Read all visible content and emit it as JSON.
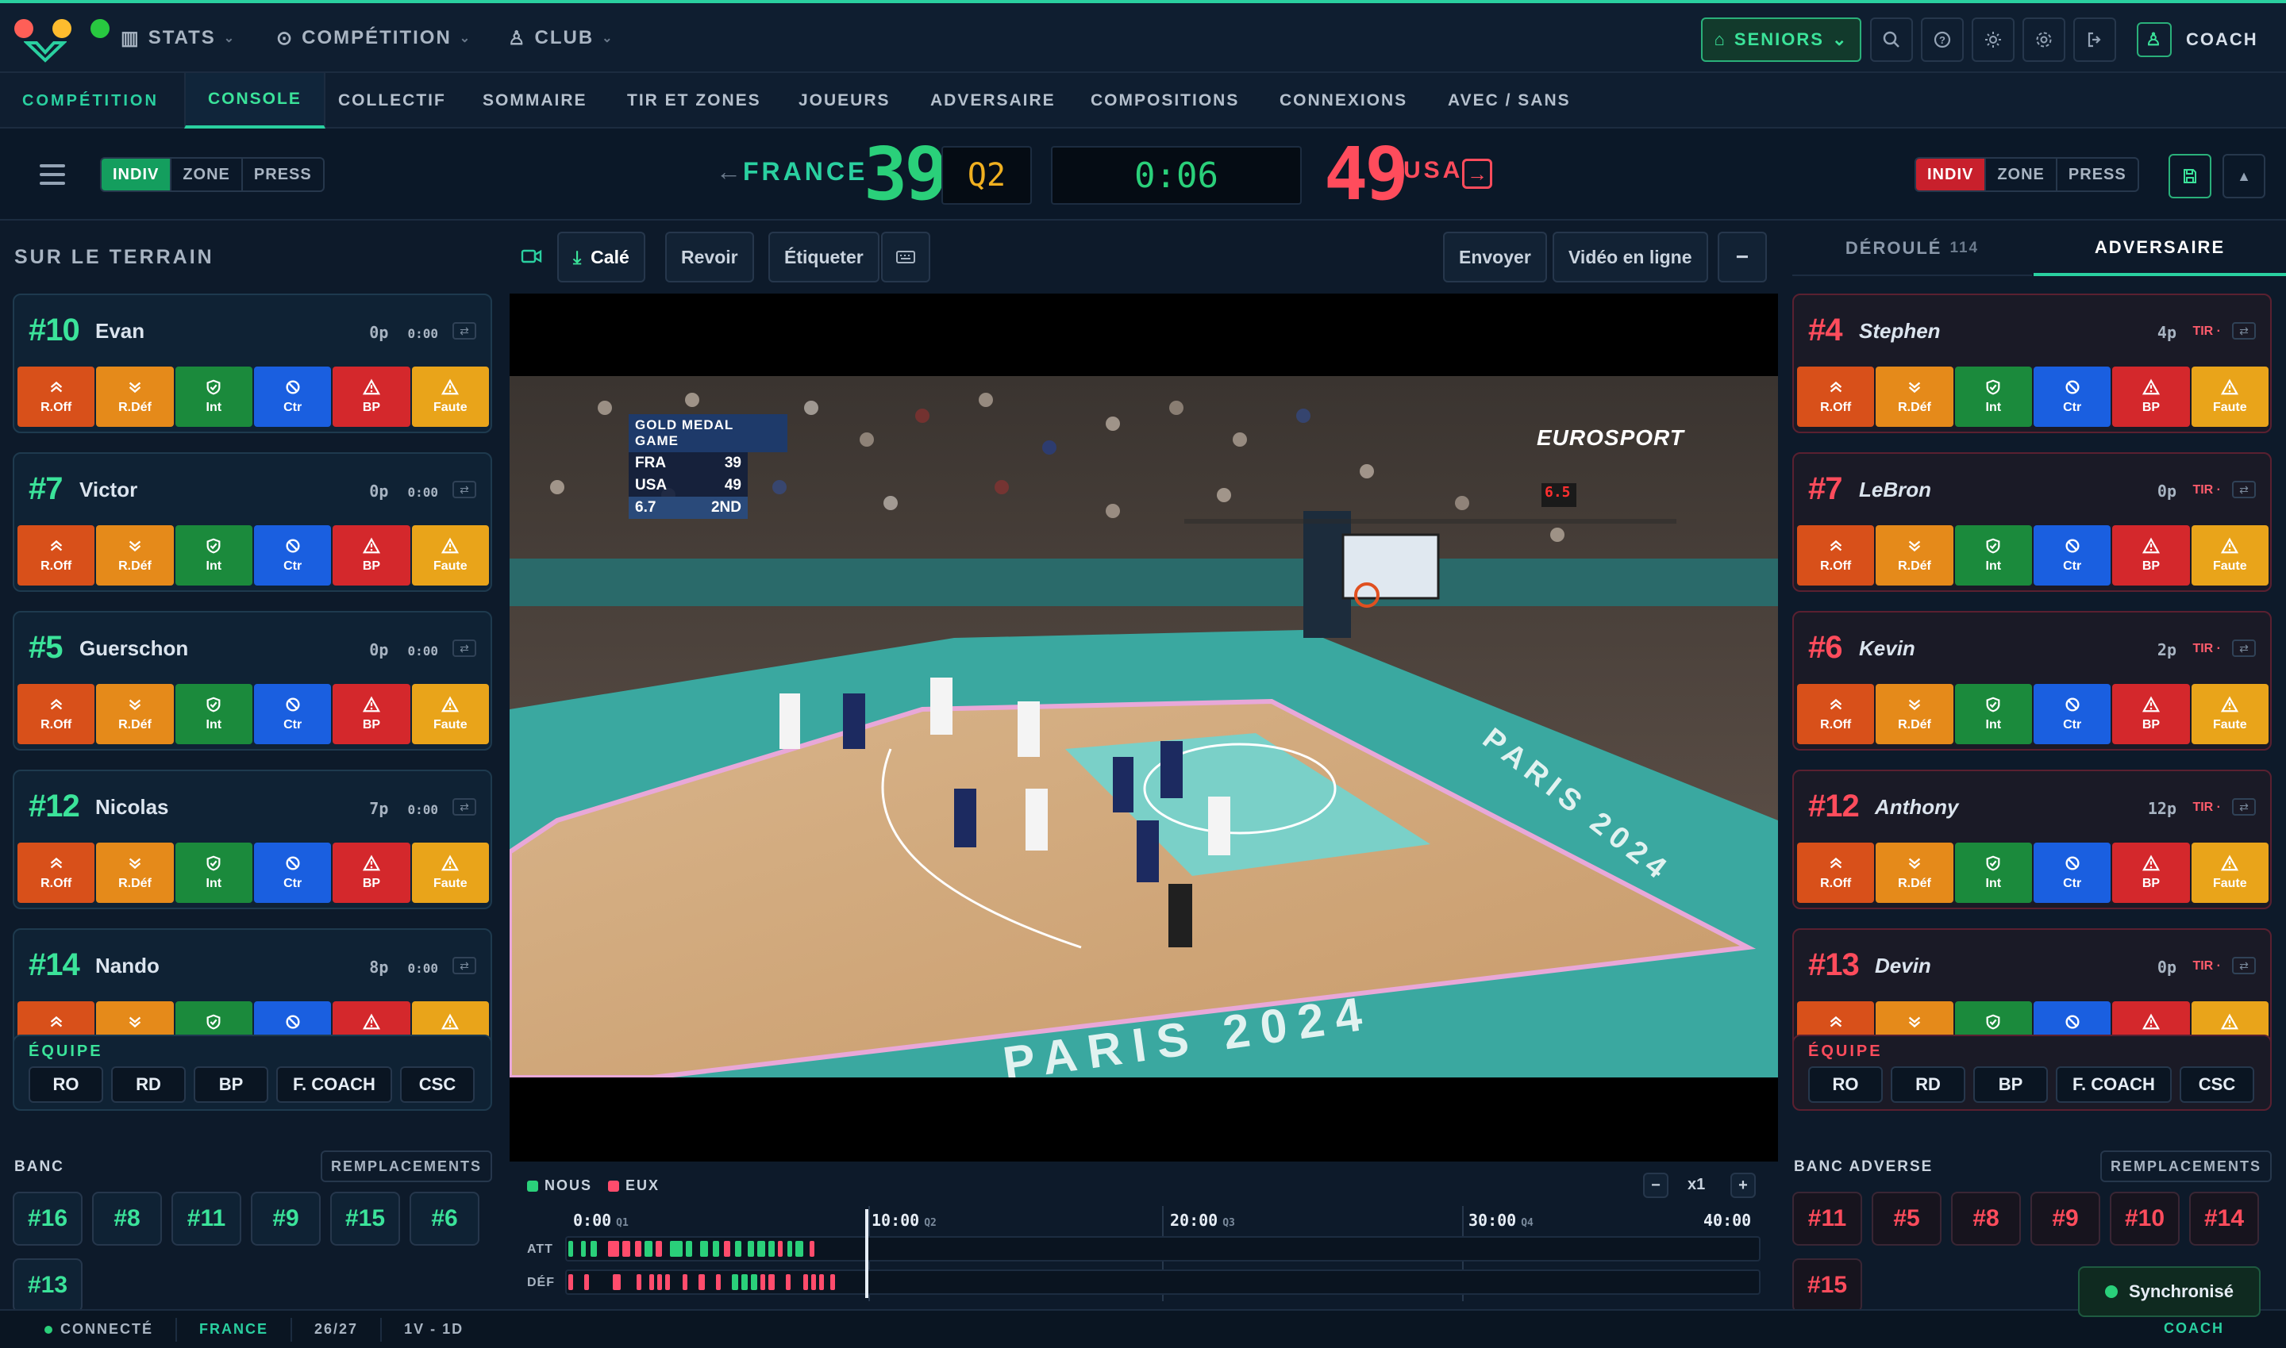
{
  "topbar": {
    "menus": [
      {
        "icon": "chart-icon",
        "label": "STATS"
      },
      {
        "icon": "trophy-icon",
        "label": "COMPÉTITION"
      },
      {
        "icon": "users-icon",
        "label": "CLUB"
      }
    ],
    "team_selector": "SENIORS",
    "user_label": "COACH"
  },
  "tabs": {
    "section": "COMPÉTITION",
    "items": [
      "CONSOLE",
      "COLLECTIF",
      "SOMMAIRE",
      "TIR ET ZONES",
      "JOUEURS",
      "ADVERSAIRE",
      "COMPOSITIONS",
      "CONNEXIONS",
      "AVEC / SANS"
    ],
    "active": "CONSOLE"
  },
  "scoreboard": {
    "left_defense": [
      "INDIV",
      "ZONE",
      "PRESS"
    ],
    "right_defense": [
      "INDIV",
      "ZONE",
      "PRESS"
    ],
    "home_team": "FRANCE",
    "home_score": "39",
    "period": "Q2",
    "clock": "0:06",
    "away_score": "49",
    "away_team": "USA"
  },
  "left_panel": {
    "title": "SUR LE TERRAIN",
    "players": [
      {
        "number": "#10",
        "name": "Evan",
        "points": "0p",
        "time": "0:00"
      },
      {
        "number": "#7",
        "name": "Victor",
        "points": "0p",
        "time": "0:00"
      },
      {
        "number": "#5",
        "name": "Guerschon",
        "points": "0p",
        "time": "0:00"
      },
      {
        "number": "#12",
        "name": "Nicolas",
        "points": "7p",
        "time": "0:00"
      },
      {
        "number": "#14",
        "name": "Nando",
        "points": "8p",
        "time": "0:00"
      }
    ],
    "actions": [
      "R.Off",
      "R.Déf",
      "Int",
      "Ctr",
      "BP",
      "Faute"
    ],
    "team_label": "ÉQUIPE",
    "team_buttons": [
      "RO",
      "RD",
      "BP",
      "F. COACH",
      "CSC"
    ],
    "bench_label": "BANC",
    "replacements_label": "REMPLACEMENTS",
    "bench": [
      "#16",
      "#8",
      "#11",
      "#9",
      "#15",
      "#6",
      "#13"
    ]
  },
  "video_toolbar": {
    "synced": "Calé",
    "review": "Revoir",
    "tag": "Étiqueter",
    "send": "Envoyer",
    "online": "Vidéo en ligne"
  },
  "video_overlay": {
    "header": "GOLD MEDAL GAME",
    "rows": [
      {
        "team": "FRA",
        "score": "39"
      },
      {
        "team": "USA",
        "score": "49"
      }
    ],
    "clock": "6.7",
    "period": "2ND",
    "broadcaster": "EUROSPORT",
    "shot_clock": "6.5",
    "court_text": "PARIS 2024"
  },
  "timeline": {
    "legend_us": "NOUS",
    "legend_them": "EUX",
    "zoom": "x1",
    "ticks": [
      {
        "time": "0:00",
        "q": "Q1"
      },
      {
        "time": "10:00",
        "q": "Q2"
      },
      {
        "time": "20:00",
        "q": "Q3"
      },
      {
        "time": "30:00",
        "q": "Q4"
      },
      {
        "time": "40:00",
        "q": ""
      }
    ],
    "row_att": "ATT",
    "row_def": "DÉF"
  },
  "right_panel": {
    "tab_flow": "DÉROULÉ",
    "tab_flow_count": "114",
    "tab_opponent": "ADVERSAIRE",
    "shot_label": "TIR",
    "players": [
      {
        "number": "#4",
        "name": "Stephen",
        "points": "4p"
      },
      {
        "number": "#7",
        "name": "LeBron",
        "points": "0p"
      },
      {
        "number": "#6",
        "name": "Kevin",
        "points": "2p"
      },
      {
        "number": "#12",
        "name": "Anthony",
        "points": "12p"
      },
      {
        "number": "#13",
        "name": "Devin",
        "points": "0p"
      }
    ],
    "team_label": "ÉQUIPE",
    "team_buttons": [
      "RO",
      "RD",
      "BP",
      "F. COACH",
      "CSC"
    ],
    "bench_label": "BANC ADVERSE",
    "replacements_label": "REMPLACEMENTS",
    "bench": [
      "#11",
      "#5",
      "#8",
      "#9",
      "#10",
      "#14",
      "#15"
    ]
  },
  "status": {
    "connection": "CONNECTÉ",
    "team": "FRANCE",
    "season": "26/27",
    "record": "1V - 1D",
    "sync_label": "Synchronisé",
    "role": "COACH"
  }
}
